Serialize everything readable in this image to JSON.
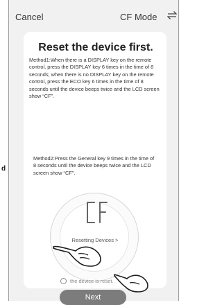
{
  "edge_fragment": "d",
  "header": {
    "cancel_label": "Cancel",
    "title": "CF Mode",
    "switch_icon": "swap-arrows-icon"
  },
  "instructions": {
    "heading": "Reset the device first.",
    "method1": "Method1:When there is a DISPLAY key on the remote control, press the DISPLAY key 6 times in the time of 8 seconds; when there is no DISPLAY key on the remote control, press the ECO key 6 times in the time of 8 seconds until the device beeps twice and the LCD screen show “CF”.",
    "method2": "Method2:Press the General key 9 times in the time of 8 seconds until the device beeps twice and the LCD screen show “CF”."
  },
  "lcd_display": {
    "icon": "lcd-cf-icon"
  },
  "resetting_link": "Resetting Devices >",
  "confirmation": {
    "label": "the device is reset.",
    "checked": false
  },
  "next_label": "Next",
  "colors": {
    "page_background": "#f1f1f1",
    "card_background": "#ffffff",
    "button_gray": "#7c7c7c",
    "text_dark": "#222222"
  }
}
